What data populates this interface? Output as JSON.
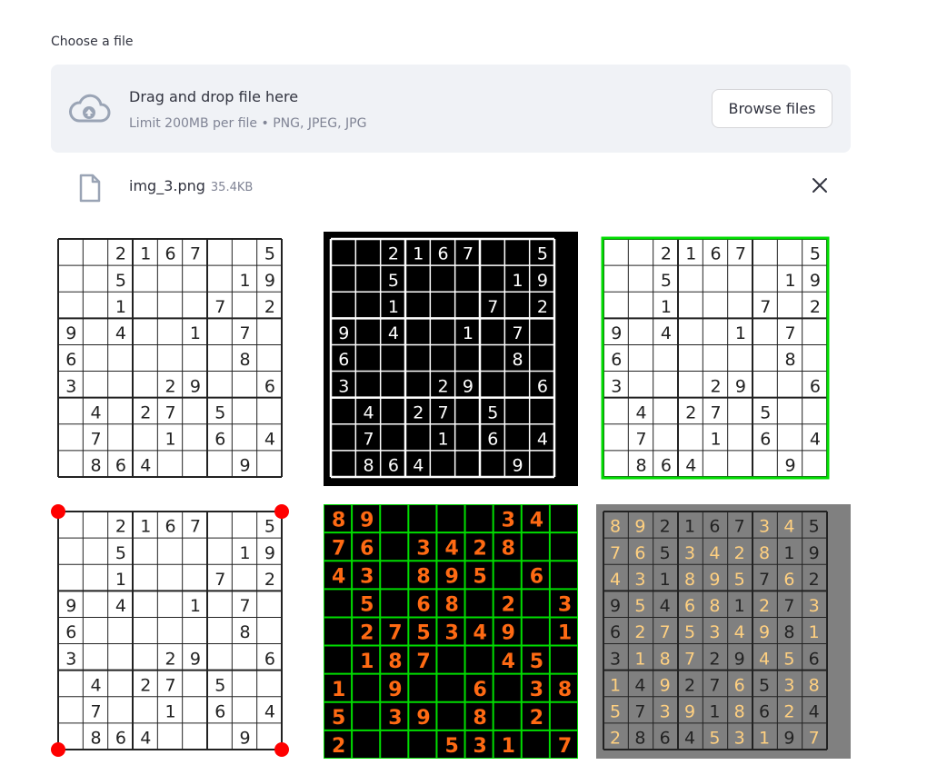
{
  "uploader": {
    "label": "Choose a file",
    "drop_title": "Drag and drop file here",
    "drop_subtitle": "Limit 200MB per file • PNG, JPEG, JPG",
    "browse_label": "Browse files",
    "upload_icon": "cloud-upload-icon"
  },
  "file": {
    "name": "img_3.png",
    "size": "35.4KB",
    "file_icon": "file-icon",
    "remove_icon": "close-icon"
  },
  "colors": {
    "accent_green": "#00dd00",
    "corner_red": "#ff0000",
    "solution_orange": "#ff6a13",
    "overlay_gold": "#ffd080",
    "gray_bg": "#808080"
  },
  "puzzle": [
    [
      0,
      0,
      2,
      1,
      6,
      7,
      0,
      0,
      5
    ],
    [
      0,
      0,
      5,
      0,
      0,
      0,
      0,
      1,
      9
    ],
    [
      0,
      0,
      1,
      0,
      0,
      0,
      7,
      0,
      2
    ],
    [
      9,
      0,
      4,
      0,
      0,
      1,
      0,
      7,
      0
    ],
    [
      6,
      0,
      0,
      0,
      0,
      0,
      0,
      8,
      0
    ],
    [
      3,
      0,
      0,
      0,
      2,
      9,
      0,
      0,
      6
    ],
    [
      0,
      4,
      0,
      2,
      7,
      0,
      5,
      0,
      0
    ],
    [
      0,
      7,
      0,
      0,
      1,
      0,
      6,
      0,
      4
    ],
    [
      0,
      8,
      6,
      4,
      0,
      0,
      0,
      9,
      0
    ]
  ],
  "solution_cells": [
    [
      8,
      9,
      0,
      0,
      0,
      0,
      3,
      4,
      0
    ],
    [
      7,
      6,
      0,
      3,
      4,
      2,
      8,
      0,
      0
    ],
    [
      4,
      3,
      0,
      8,
      9,
      5,
      0,
      6,
      0
    ],
    [
      0,
      5,
      0,
      6,
      8,
      0,
      2,
      0,
      3
    ],
    [
      0,
      2,
      7,
      5,
      3,
      4,
      9,
      0,
      1
    ],
    [
      0,
      1,
      8,
      7,
      0,
      0,
      4,
      5,
      0
    ],
    [
      1,
      0,
      9,
      0,
      0,
      6,
      0,
      3,
      8
    ],
    [
      5,
      0,
      3,
      9,
      0,
      8,
      0,
      2,
      0
    ],
    [
      2,
      0,
      0,
      0,
      5,
      3,
      1,
      0,
      7
    ]
  ]
}
